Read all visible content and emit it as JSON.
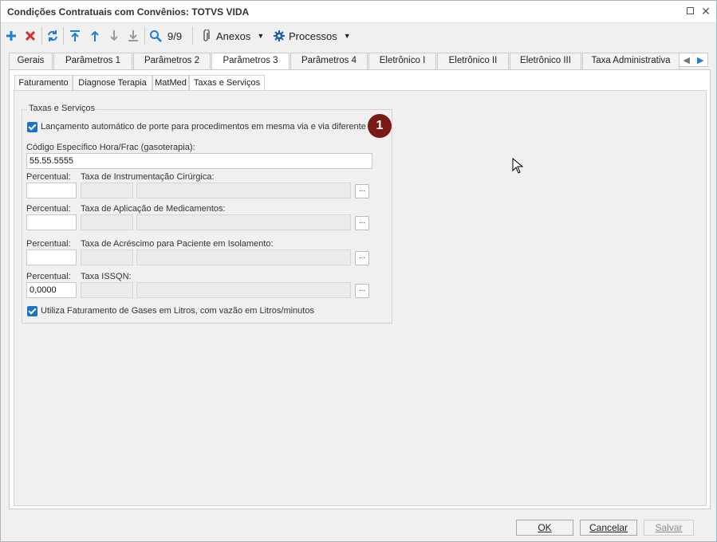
{
  "window": {
    "title": "Condições Contratuais com Convênios: TOTVS VIDA"
  },
  "toolbar": {
    "add_icon": "plus-icon",
    "delete_icon": "x-icon",
    "refresh_icon": "refresh-icon",
    "first_icon": "arrow-to-top-icon",
    "prev_icon": "arrow-up-icon",
    "next_icon": "arrow-down-icon",
    "last_icon": "arrow-to-bottom-icon",
    "search_icon": "magnifier-icon",
    "record_counter": "9/9",
    "attachments_label": "Anexos",
    "processes_label": "Processos"
  },
  "main_tabs": [
    {
      "label": "Gerais"
    },
    {
      "label": "Parâmetros 1"
    },
    {
      "label": "Parâmetros 2"
    },
    {
      "label": "Parâmetros 3",
      "active": true
    },
    {
      "label": "Parâmetros 4"
    },
    {
      "label": "Eletrônico I"
    },
    {
      "label": "Eletrônico II"
    },
    {
      "label": "Eletrônico III"
    },
    {
      "label": "Taxa Administrativa"
    }
  ],
  "sub_tabs": [
    {
      "label": "Faturamento"
    },
    {
      "label": "Diagnose Terapia"
    },
    {
      "label": "MatMed"
    },
    {
      "label": "Taxas e Serviços",
      "active": true
    }
  ],
  "group": {
    "title": "Taxas e Serviços",
    "auto_porte": {
      "label": "Lançamento automático de porte para procedimentos em mesma via e via diferente",
      "checked": true
    },
    "badge": "1",
    "gas_code": {
      "label": "Código Específico Hora/Frac (gasoterapia):",
      "value": "55.55.5555"
    },
    "rows": [
      {
        "pct_label": "Percentual:",
        "tax_label": "Taxa de Instrumentação Cirúrgica:",
        "pct_value": ""
      },
      {
        "pct_label": "Percentual:",
        "tax_label": "Taxa de Aplicação de Medicamentos:",
        "pct_value": ""
      },
      {
        "pct_label": "Percentual:",
        "tax_label": "Taxa de Acréscimo para Paciente em Isolamento:",
        "pct_value": ""
      },
      {
        "pct_label": "Percentual:",
        "tax_label": "Taxa ISSQN:",
        "pct_value": "0,0000"
      }
    ],
    "lookup_label": "...",
    "gas_liters": {
      "label": "Utiliza Faturamento de Gases em Litros, com vazão em Litros/minutos",
      "checked": true
    }
  },
  "footer": {
    "ok_label": "OK",
    "cancel_label": "Cancelar",
    "save_label": "Salvar"
  },
  "colors": {
    "accent": "#1a73c8",
    "badge": "#7a1a14",
    "delete": "#d32f2f"
  }
}
